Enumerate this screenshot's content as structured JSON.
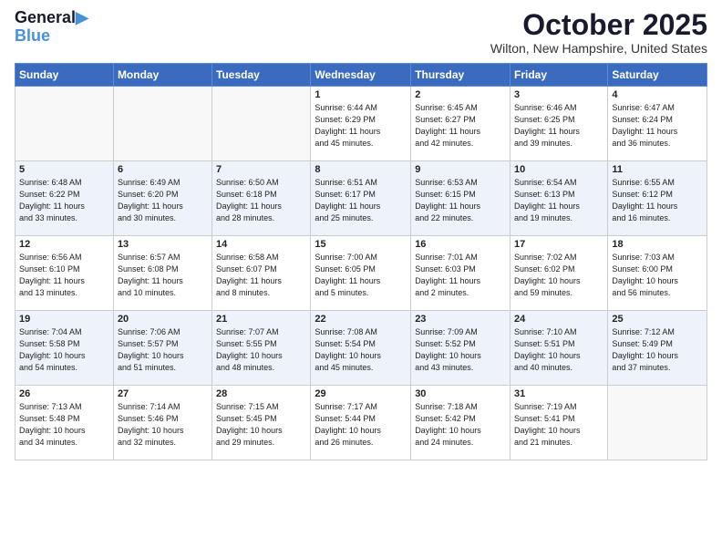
{
  "header": {
    "logo_line1": "General",
    "logo_line2": "Blue",
    "month": "October 2025",
    "location": "Wilton, New Hampshire, United States"
  },
  "weekdays": [
    "Sunday",
    "Monday",
    "Tuesday",
    "Wednesday",
    "Thursday",
    "Friday",
    "Saturday"
  ],
  "weeks": [
    [
      {
        "day": "",
        "info": ""
      },
      {
        "day": "",
        "info": ""
      },
      {
        "day": "",
        "info": ""
      },
      {
        "day": "1",
        "info": "Sunrise: 6:44 AM\nSunset: 6:29 PM\nDaylight: 11 hours\nand 45 minutes."
      },
      {
        "day": "2",
        "info": "Sunrise: 6:45 AM\nSunset: 6:27 PM\nDaylight: 11 hours\nand 42 minutes."
      },
      {
        "day": "3",
        "info": "Sunrise: 6:46 AM\nSunset: 6:25 PM\nDaylight: 11 hours\nand 39 minutes."
      },
      {
        "day": "4",
        "info": "Sunrise: 6:47 AM\nSunset: 6:24 PM\nDaylight: 11 hours\nand 36 minutes."
      }
    ],
    [
      {
        "day": "5",
        "info": "Sunrise: 6:48 AM\nSunset: 6:22 PM\nDaylight: 11 hours\nand 33 minutes."
      },
      {
        "day": "6",
        "info": "Sunrise: 6:49 AM\nSunset: 6:20 PM\nDaylight: 11 hours\nand 30 minutes."
      },
      {
        "day": "7",
        "info": "Sunrise: 6:50 AM\nSunset: 6:18 PM\nDaylight: 11 hours\nand 28 minutes."
      },
      {
        "day": "8",
        "info": "Sunrise: 6:51 AM\nSunset: 6:17 PM\nDaylight: 11 hours\nand 25 minutes."
      },
      {
        "day": "9",
        "info": "Sunrise: 6:53 AM\nSunset: 6:15 PM\nDaylight: 11 hours\nand 22 minutes."
      },
      {
        "day": "10",
        "info": "Sunrise: 6:54 AM\nSunset: 6:13 PM\nDaylight: 11 hours\nand 19 minutes."
      },
      {
        "day": "11",
        "info": "Sunrise: 6:55 AM\nSunset: 6:12 PM\nDaylight: 11 hours\nand 16 minutes."
      }
    ],
    [
      {
        "day": "12",
        "info": "Sunrise: 6:56 AM\nSunset: 6:10 PM\nDaylight: 11 hours\nand 13 minutes."
      },
      {
        "day": "13",
        "info": "Sunrise: 6:57 AM\nSunset: 6:08 PM\nDaylight: 11 hours\nand 10 minutes."
      },
      {
        "day": "14",
        "info": "Sunrise: 6:58 AM\nSunset: 6:07 PM\nDaylight: 11 hours\nand 8 minutes."
      },
      {
        "day": "15",
        "info": "Sunrise: 7:00 AM\nSunset: 6:05 PM\nDaylight: 11 hours\nand 5 minutes."
      },
      {
        "day": "16",
        "info": "Sunrise: 7:01 AM\nSunset: 6:03 PM\nDaylight: 11 hours\nand 2 minutes."
      },
      {
        "day": "17",
        "info": "Sunrise: 7:02 AM\nSunset: 6:02 PM\nDaylight: 10 hours\nand 59 minutes."
      },
      {
        "day": "18",
        "info": "Sunrise: 7:03 AM\nSunset: 6:00 PM\nDaylight: 10 hours\nand 56 minutes."
      }
    ],
    [
      {
        "day": "19",
        "info": "Sunrise: 7:04 AM\nSunset: 5:58 PM\nDaylight: 10 hours\nand 54 minutes."
      },
      {
        "day": "20",
        "info": "Sunrise: 7:06 AM\nSunset: 5:57 PM\nDaylight: 10 hours\nand 51 minutes."
      },
      {
        "day": "21",
        "info": "Sunrise: 7:07 AM\nSunset: 5:55 PM\nDaylight: 10 hours\nand 48 minutes."
      },
      {
        "day": "22",
        "info": "Sunrise: 7:08 AM\nSunset: 5:54 PM\nDaylight: 10 hours\nand 45 minutes."
      },
      {
        "day": "23",
        "info": "Sunrise: 7:09 AM\nSunset: 5:52 PM\nDaylight: 10 hours\nand 43 minutes."
      },
      {
        "day": "24",
        "info": "Sunrise: 7:10 AM\nSunset: 5:51 PM\nDaylight: 10 hours\nand 40 minutes."
      },
      {
        "day": "25",
        "info": "Sunrise: 7:12 AM\nSunset: 5:49 PM\nDaylight: 10 hours\nand 37 minutes."
      }
    ],
    [
      {
        "day": "26",
        "info": "Sunrise: 7:13 AM\nSunset: 5:48 PM\nDaylight: 10 hours\nand 34 minutes."
      },
      {
        "day": "27",
        "info": "Sunrise: 7:14 AM\nSunset: 5:46 PM\nDaylight: 10 hours\nand 32 minutes."
      },
      {
        "day": "28",
        "info": "Sunrise: 7:15 AM\nSunset: 5:45 PM\nDaylight: 10 hours\nand 29 minutes."
      },
      {
        "day": "29",
        "info": "Sunrise: 7:17 AM\nSunset: 5:44 PM\nDaylight: 10 hours\nand 26 minutes."
      },
      {
        "day": "30",
        "info": "Sunrise: 7:18 AM\nSunset: 5:42 PM\nDaylight: 10 hours\nand 24 minutes."
      },
      {
        "day": "31",
        "info": "Sunrise: 7:19 AM\nSunset: 5:41 PM\nDaylight: 10 hours\nand 21 minutes."
      },
      {
        "day": "",
        "info": ""
      }
    ]
  ]
}
